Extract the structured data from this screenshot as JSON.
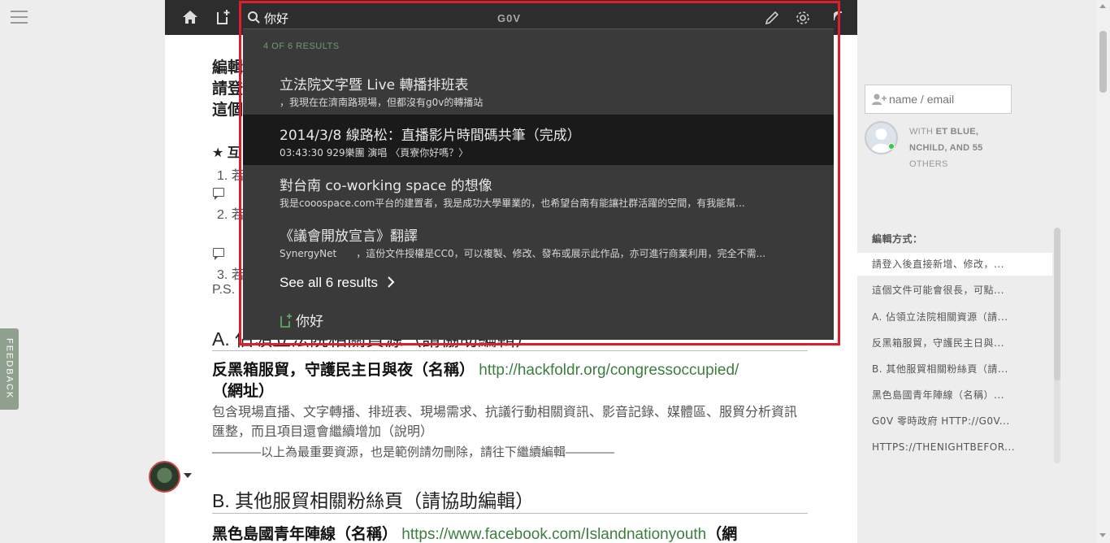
{
  "app": {
    "brand": "G0V"
  },
  "search": {
    "query": "你好",
    "results_count": "4 OF 6 RESULTS",
    "results": [
      {
        "title": "立法院文字暨 Live 轉播排班表",
        "snippet": "，我現在在濟南路現場，但都沒有g0v的轉播站"
      },
      {
        "title": "2014/3/8 線路松：直播影片時間碼共筆（完成）",
        "snippet": "03:43:30 929樂團 演唱 〈頁寮你好嗎？〉"
      },
      {
        "title": "對台南 co-working space 的想像",
        "snippet": "我是cooospace.com平台的建置者，我是成功大學畢業的，也希望台南有能讓社群活躍的空間，有我能幫..."
      },
      {
        "title": "《議會開放宣言》翻譯",
        "snippet": "SynergyNet　　，這份文件授權是CC0，可以複製、修改、發布或展示此作品，亦可進行商業利用，完全不需..."
      }
    ],
    "see_all": "See all 6 results",
    "new_doc": "你好"
  },
  "doc": {
    "edit_heading": "編輯方式：",
    "line_a": "請登入後直接新增、修改",
    "line_b": "這個文件可能會很長",
    "bg_snippets": [
      "★ 互",
      "1. 若",
      "2. 若",
      "3. 若",
      "P.S."
    ],
    "section_a": "A. 佔領立法院相關資源（請協助編輯）",
    "entry1_title": "反黑箱服貿，守護民主日與夜（名稱）",
    "entry1_link": "http://hackfoldr.org/congressoccupied/",
    "entry1_suffix": "（網址）",
    "entry1_desc": "包含現場直播、文字轉播、排班表、現場需求、抗議行動相關資訊、影音記錄、媒體區、服貿分析資訊匯整，而且項目還會繼續增加（說明）",
    "entry1_note": "————以上為最重要資源，也是範例請勿刪除，請往下繼續編輯————",
    "section_b": "B. 其他服貿相關粉絲頁（請協助編輯）",
    "entry2_title": "黑色島國青年陣線（名稱）",
    "entry2_link": "https://www.facebook.com/Islandnationyouth",
    "entry2_suffix": "（網"
  },
  "sidebar": {
    "invite_placeholder": "name / email",
    "with_prefix": "WITH",
    "with_names": "ET BLUE, NCHILD, AND 55",
    "with_suffix": "OTHERS",
    "toc": [
      "編輯方式：",
      "請登入後直接新增、修改，...",
      "這個文件可能會很長，可點...",
      "A. 佔領立法院相關資源（請...",
      "反黑箱服貿，守護民主日與...",
      "B. 其他服貿相關粉絲頁（請...",
      "黑色島國青年陣線（名稱）...",
      "G0V 零時政府 HTTP://G0V...",
      "HTTPS://THENIGHTBEFOR..."
    ]
  },
  "feedback_label": "FEEDBACK",
  "colors": {
    "accent_green": "#3b7f3f",
    "highlight_frame": "#e01e2a",
    "panel_bg": "#3a3a3a"
  },
  "icons": [
    "hamburger-icon",
    "home-icon",
    "new-document-icon",
    "search-icon",
    "pencil-icon",
    "gear-icon",
    "share-icon",
    "add-user-icon",
    "chevron-right-icon"
  ]
}
